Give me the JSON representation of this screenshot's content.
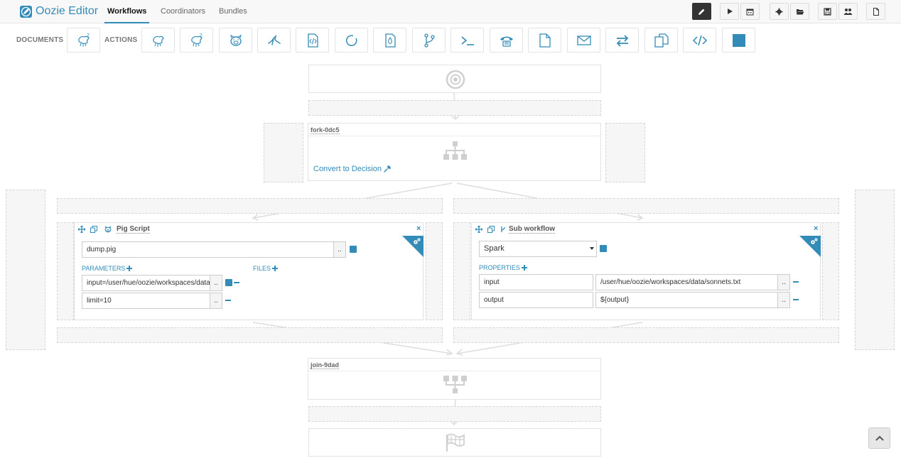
{
  "app": {
    "title": "Oozie Editor"
  },
  "nav": {
    "tabs": [
      "Workflows",
      "Coordinators",
      "Bundles"
    ],
    "active_tab": "Workflows"
  },
  "toolbar": {
    "buttons": [
      "edit-icon",
      "play-icon",
      "calendar-icon",
      "gear-icon",
      "folder-open-icon",
      "save-icon",
      "users-icon",
      "new-document-icon"
    ]
  },
  "palette": {
    "documents_label": "DOCUMENTS",
    "actions_label": "ACTIONS",
    "documents": [
      "hive2-icon"
    ],
    "actions": [
      "hive-icon",
      "hive2-icon",
      "pig-icon",
      "sqoop-icon",
      "java-icon",
      "spark-icon",
      "mapreduce-icon",
      "subworkflow-icon",
      "shell-icon",
      "ssh-icon",
      "fs-icon",
      "email-icon",
      "streaming-icon",
      "distcp-icon",
      "generic-icon",
      "kill-icon"
    ]
  },
  "fork": {
    "name": "fork-0dc5",
    "convert_link": "Convert to Decision"
  },
  "pig": {
    "title": "Pig Script",
    "script": "dump.pig",
    "params_label": "PARAMETERS",
    "files_label": "FILES",
    "params": [
      "input=/user/hue/oozie/workspaces/data",
      "limit=10"
    ]
  },
  "subwf": {
    "title": "Sub workflow",
    "selected": "Spark",
    "properties_label": "PROPERTIES",
    "properties": [
      {
        "name": "input",
        "value": "/user/hue/oozie/workspaces/data/sonnets.txt"
      },
      {
        "name": "output",
        "value": "${output}"
      }
    ]
  },
  "join": {
    "name": "join-9dad"
  },
  "dots_label": "..",
  "close_label": "×"
}
